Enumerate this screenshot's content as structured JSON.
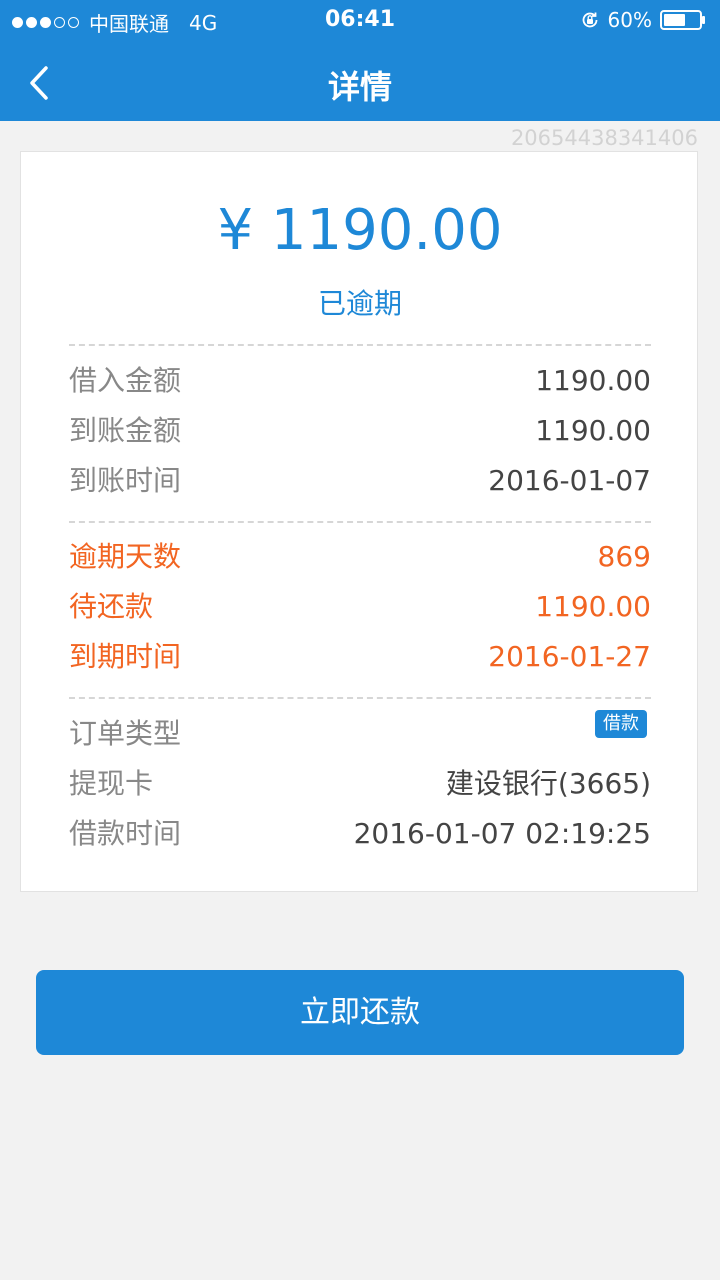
{
  "status_bar": {
    "carrier": "中国联通",
    "network": "4G",
    "time": "06:41",
    "battery": "60%",
    "signal_bars": [
      true,
      true,
      true,
      false,
      false
    ]
  },
  "nav": {
    "title": "详情",
    "back_icon": "chevron-left-icon"
  },
  "order_id": "20654438341406",
  "summary": {
    "amount": "¥ 1190.00",
    "status": "已逾期"
  },
  "section1": [
    {
      "label": "借入金额",
      "value": "1190.00"
    },
    {
      "label": "到账金额",
      "value": "1190.00"
    },
    {
      "label": "到账时间",
      "value": "2016-01-07"
    }
  ],
  "section2": [
    {
      "label": "逾期天数",
      "value": "869"
    },
    {
      "label": "待还款",
      "value": "1190.00"
    },
    {
      "label": "到期时间",
      "value": "2016-01-27"
    }
  ],
  "section3": {
    "order_type": {
      "label": "订单类型",
      "tag": "借款"
    },
    "withdraw_card": {
      "label": "提现卡",
      "value": "建设银行(3665)"
    },
    "borrow_time": {
      "label": "借款时间",
      "value": "2016-01-07 02:19:25"
    }
  },
  "action": {
    "repay_label": "立即还款"
  },
  "colors": {
    "primary": "#1e88d7",
    "alert": "#f26522",
    "background": "#f2f2f2"
  }
}
